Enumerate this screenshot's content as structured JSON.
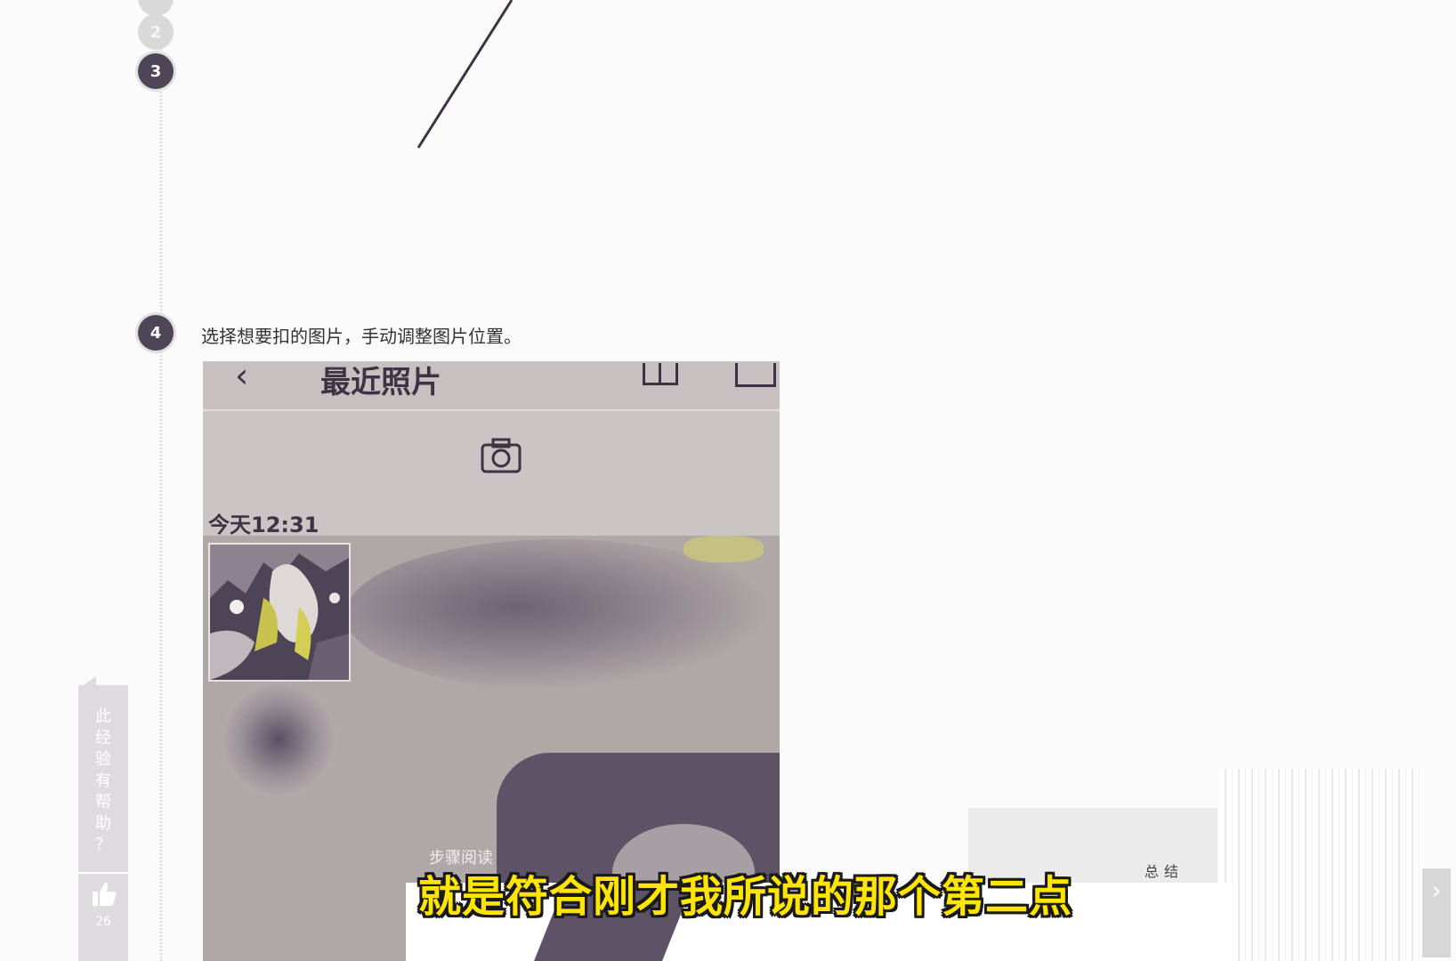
{
  "steps": [
    {
      "number": "2",
      "state": "done"
    },
    {
      "number": "3",
      "state": "done"
    },
    {
      "number": "4",
      "text": "选择想要扣的图片，手动调整图片位置。"
    }
  ],
  "phone": {
    "back_icon": "chevron-left-icon",
    "title": "最近照片",
    "date_label": "今天12:31",
    "camera_icon": "camera-icon"
  },
  "side_panel": {
    "text": "此经验有帮助？",
    "like_icon": "thumbs-up-icon",
    "like_count": "26"
  },
  "step_read_label": "步骤阅读",
  "summary_label": "总结",
  "subtitle": "就是符合刚才我所说的那个第二点",
  "colors": {
    "accent_dark": "#4e4556",
    "subtitle_yellow": "#ffe500"
  }
}
